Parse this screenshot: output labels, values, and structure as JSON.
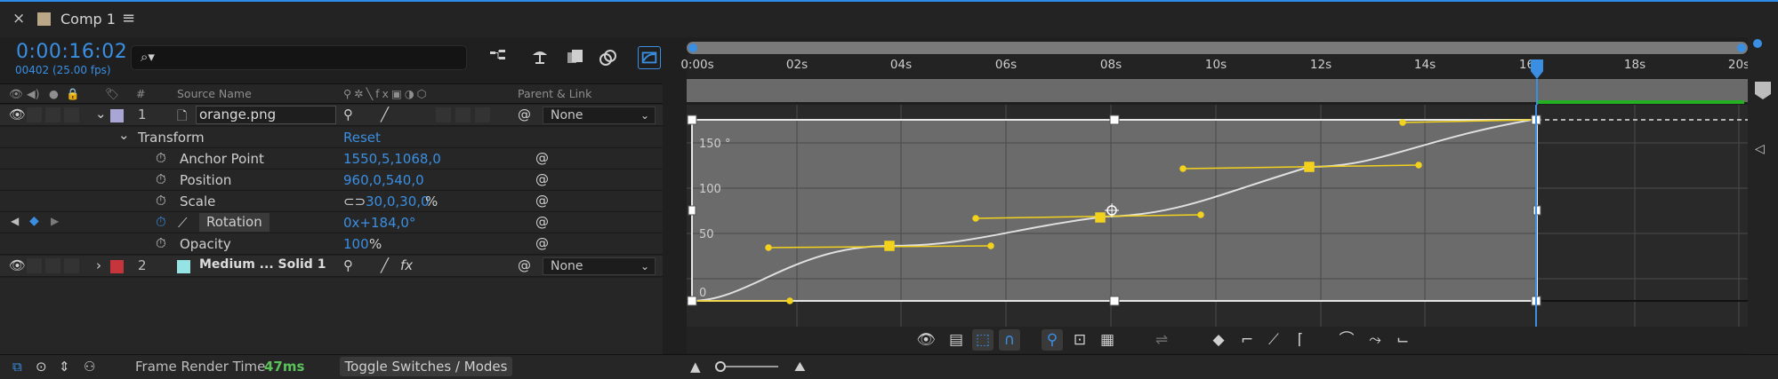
{
  "tab": {
    "close": "×",
    "title": "Comp 1",
    "menu": "≡"
  },
  "header": {
    "timecode": "0:00:16:02",
    "frame_info": "00402 (25.00 fps)",
    "search_icon": "⌕▾"
  },
  "columns": {
    "hash": "#",
    "source_name": "Source Name",
    "parent_link": "Parent & Link"
  },
  "layers": [
    {
      "index": "1",
      "name": "orange.png",
      "parent": "None",
      "label_color": "#a9a6d6",
      "thumb_icon": "file-icon"
    },
    {
      "index": "2",
      "name": "Medium ... Solid 1",
      "parent": "None",
      "label_color": "#c6353b",
      "thumb_color": "#96e3e3"
    }
  ],
  "transform": {
    "label": "Transform",
    "reset": "Reset",
    "properties": [
      {
        "name": "Anchor Point",
        "value": "1550,5,1068,0"
      },
      {
        "name": "Position",
        "value": "960,0,540,0"
      },
      {
        "name": "Scale",
        "value": "30,0,30,0",
        "unit": "%"
      },
      {
        "name": "Rotation",
        "value": "0x+184,0°"
      },
      {
        "name": "Opacity",
        "value": "100",
        "unit": "%"
      }
    ]
  },
  "bottom": {
    "frame_render_label": "Frame Render Time",
    "frame_render_value": "47ms",
    "toggle_label": "Toggle Switches / Modes"
  },
  "ruler_labels": [
    "0:00s",
    "02s",
    "04s",
    "06s",
    "08s",
    "10s",
    "12s",
    "14s",
    "16s",
    "18s",
    "20s"
  ],
  "graph": {
    "y_labels": [
      "150 °",
      "100",
      "50",
      "0"
    ],
    "current_time_label": "16s"
  },
  "colors": {
    "accent": "#3a8fe3",
    "curve_handle": "#f2d21c",
    "work_area_green": "#23b123"
  }
}
